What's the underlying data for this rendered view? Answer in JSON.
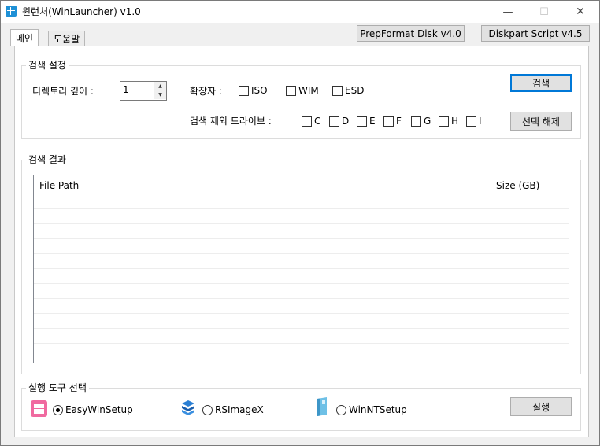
{
  "window": {
    "title": "윈런처(WinLauncher) v1.0",
    "minimize_glyph": "—",
    "maximize_glyph": "☐",
    "close_glyph": "✕",
    "icon": "windows-logo-icon"
  },
  "tabs": [
    {
      "label": "메인",
      "active": true
    },
    {
      "label": "도움말",
      "active": false
    }
  ],
  "toolbar": {
    "prepformat_label": "PrepFormat Disk v4.0",
    "diskpart_label": "Diskpart Script v4.5"
  },
  "search_settings": {
    "group_label": "검색 설정",
    "depth_label": "디렉토리 깊이 :",
    "depth_value": "1",
    "ext_label": "확장자 :",
    "extensions": [
      "ISO",
      "WIM",
      "ESD"
    ],
    "exclude_label": "검색 제외 드라이브 :",
    "drives": [
      "C",
      "D",
      "E",
      "F",
      "G",
      "H",
      "I"
    ],
    "search_button": "검색",
    "deselect_button": "선택 해제"
  },
  "results": {
    "group_label": "검색 결과",
    "columns": [
      "File Path",
      "Size (GB)"
    ],
    "rows": []
  },
  "tool_select": {
    "group_label": "실행 도구 선택",
    "tools": [
      {
        "label": "EasyWinSetup",
        "selected": true,
        "icon": "easywinsetup-icon"
      },
      {
        "label": "RSImageX",
        "selected": false,
        "icon": "rsimagex-icon"
      },
      {
        "label": "WinNTSetup",
        "selected": false,
        "icon": "winntsetup-icon"
      }
    ],
    "run_button": "실행"
  },
  "colors": {
    "accent": "#0078d7",
    "window_bg": "#f0f0f0",
    "panel_bg": "#ffffff",
    "button_bg": "#e1e1e1"
  }
}
